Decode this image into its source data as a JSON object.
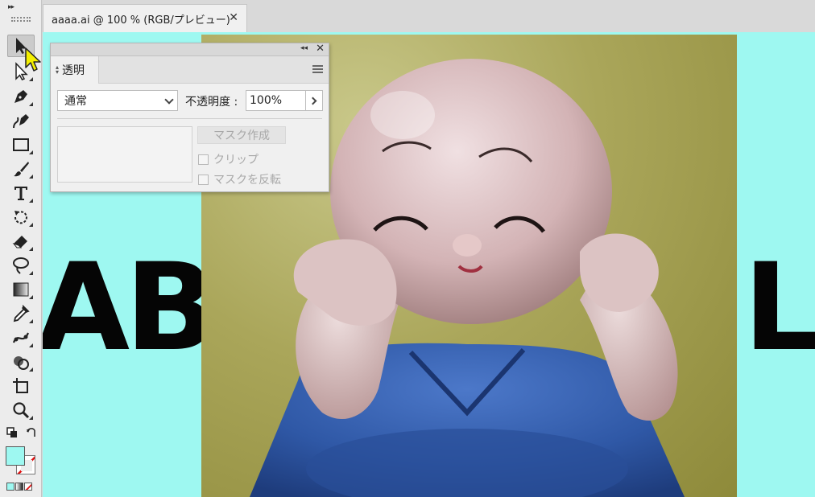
{
  "document": {
    "tab_title": "aaaa.ai @ 100 % (RGB/プレビュー)",
    "close_glyph": "✕"
  },
  "panel": {
    "tab_label": "透明",
    "blend_mode": "通常",
    "opacity_label": "不透明度 :",
    "opacity_value": "100%",
    "make_mask_label": "マスク作成",
    "clip_label": "クリップ",
    "invert_mask_label": "マスクを反転",
    "collapse_glyph": "◂◂",
    "close_glyph": "✕"
  },
  "artboard_text": {
    "left": "ABC",
    "right": "LM"
  },
  "colors": {
    "canvas_bg": "#9ef8f1",
    "fill_swatch": "#9ef8f1",
    "text": "#050505",
    "cursor": "#f4f000"
  },
  "toolbar": {
    "collapse_glyph": "▸▸",
    "tools": [
      "selection-tool",
      "direct-selection-tool",
      "pen-tool",
      "curvature-tool",
      "rectangle-tool",
      "paintbrush-tool",
      "type-tool",
      "rotate-tool",
      "eraser-tool",
      "lasso-tool",
      "gradient-tool",
      "eyedropper-tool",
      "blend-tool",
      "shape-builder-tool",
      "artboard-tool",
      "zoom-tool"
    ]
  }
}
